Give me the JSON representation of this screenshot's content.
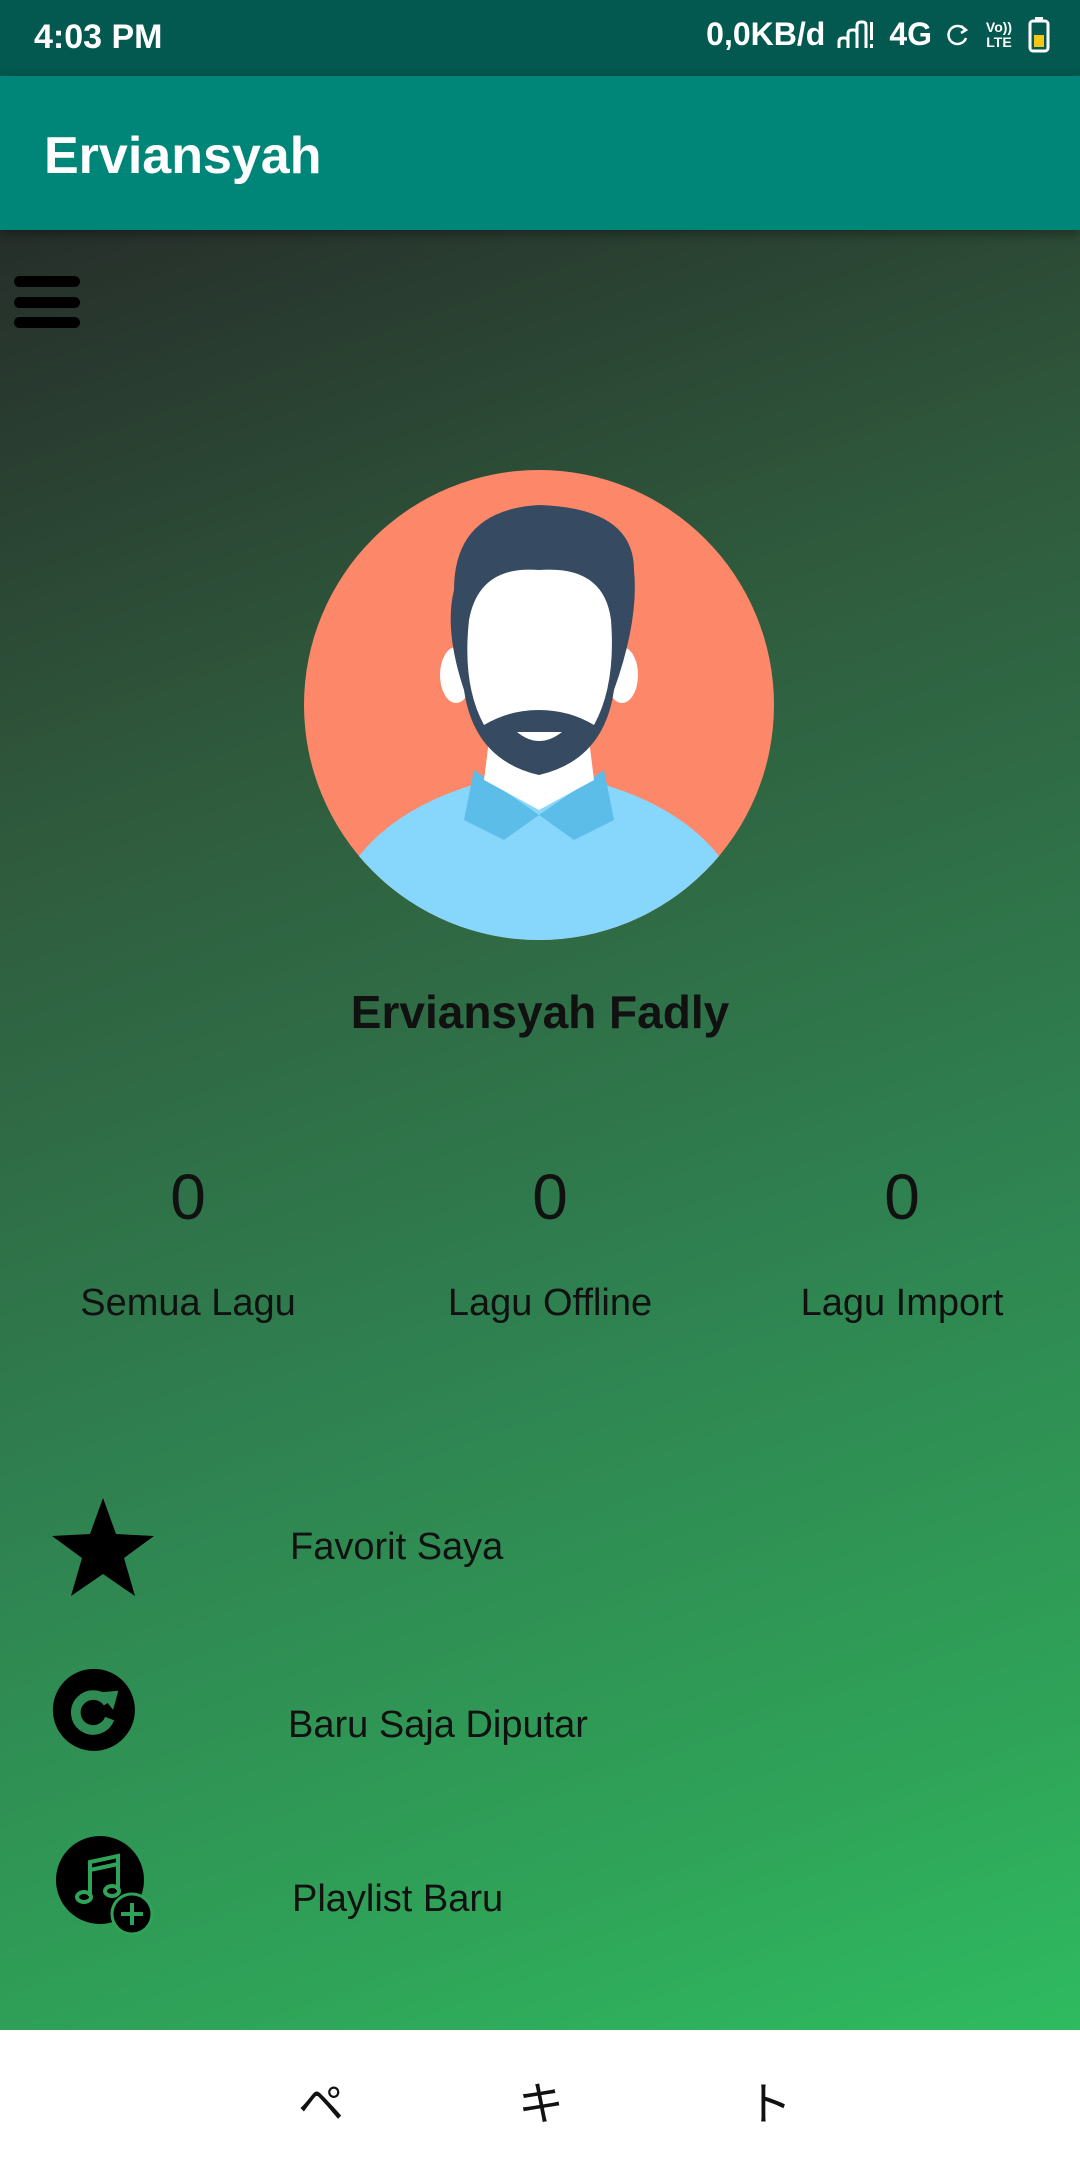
{
  "status_bar": {
    "time": "4:03 PM",
    "data_speed": "0,0KB/d",
    "network": "4G",
    "volte_line1": "Vo))",
    "volte_line2": "LTE"
  },
  "app_bar": {
    "title": "Erviansyah"
  },
  "profile": {
    "name": "Erviansyah Fadly"
  },
  "stats": [
    {
      "value": "0",
      "label": "Semua Lagu"
    },
    {
      "value": "0",
      "label": "Lagu Offline"
    },
    {
      "value": "0",
      "label": "Lagu Import"
    }
  ],
  "menu_items": [
    {
      "label": "Favorit Saya",
      "icon": "star-icon"
    },
    {
      "label": "Baru Saja Diputar",
      "icon": "recent-play-icon"
    },
    {
      "label": "Playlist Baru",
      "icon": "music-add-icon"
    }
  ],
  "nav_bar": {
    "back": "ペ",
    "home": "キ",
    "recents": "ト"
  },
  "colors": {
    "status_bar": "#03594f",
    "app_bar": "#008678",
    "gradient_top": "#262e2a",
    "gradient_bottom": "#2fbb60"
  }
}
